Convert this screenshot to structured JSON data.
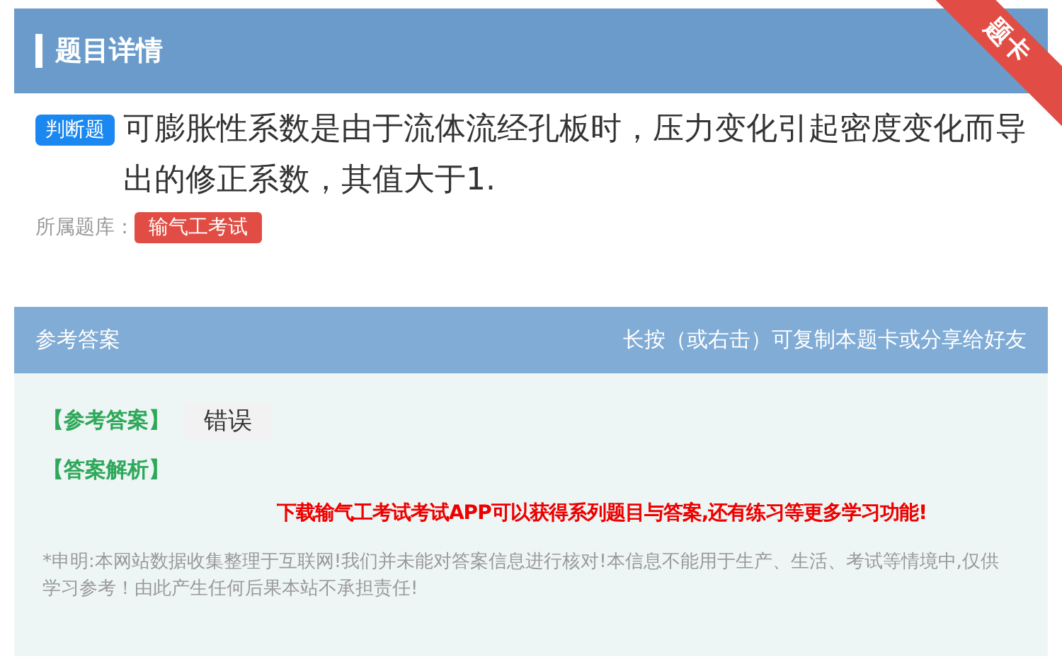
{
  "header": {
    "title": "题目详情",
    "ribbon": "题卡"
  },
  "question": {
    "type_badge": "判断题",
    "text": "可膨胀性系数是由于流体流经孔板时，压力变化引起密度变化而导出的修正系数，其值大于1.",
    "library_label": "所属题库：",
    "library": "输气工考试"
  },
  "answer_panel": {
    "title": "参考答案",
    "hint": "长按（或右击）可复制本题卡或分享给好友",
    "answer_label": "【参考答案】",
    "answer": "错误",
    "analysis_label": "【答案解析】",
    "promo": "下载输气工考试考试APP可以获得系列题目与答案,还有练习等更多学习功能!",
    "disclaimer": "*申明:本网站数据收集整理于互联网!我们并未能对答案信息进行核对!本信息不能用于生产、生活、考试等情境中,仅供学习参考！由此产生任何后果本站不承担责任!"
  }
}
